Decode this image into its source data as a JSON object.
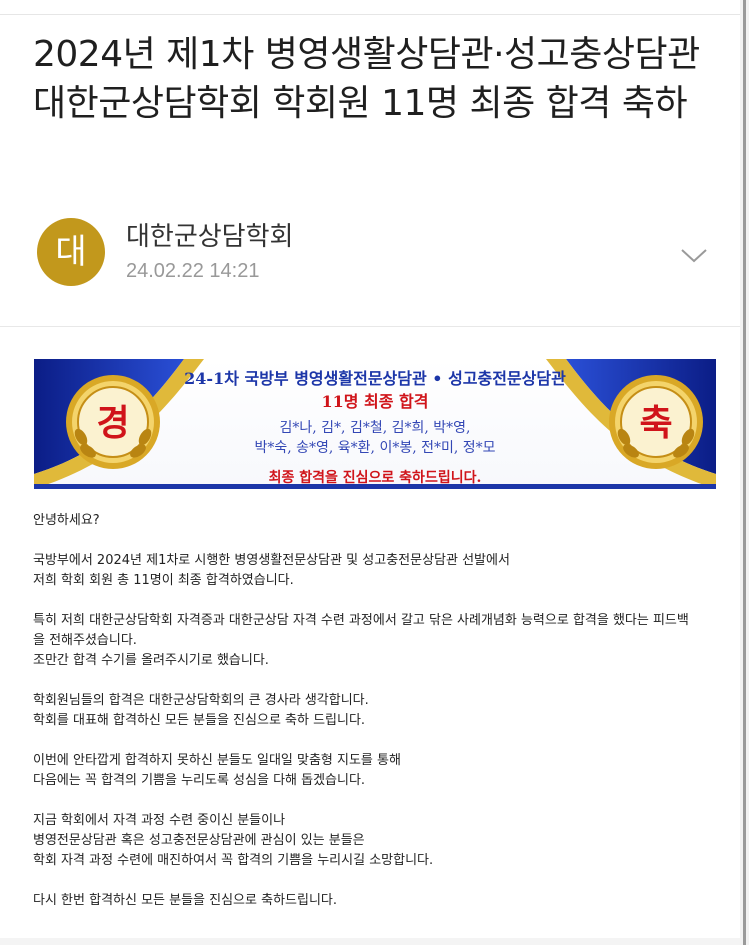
{
  "post": {
    "title": "2024년 제1차 병영생활상담관·성고충상담관 대한군상담학회 학회원 11명 최종 합격 축하",
    "avatar_char": "대",
    "author": "대한군상담학회",
    "date": "24.02.22 14:21"
  },
  "banner": {
    "line1": "24-1차 국방부 병영생활전문상담관 • 성고충전문상담관",
    "line2": "11명 최종 합격",
    "line3": "김*나, 김*, 김*철, 김*희, 박*영,",
    "line4": "박*숙, 송*영, 육*환, 이*봉, 전*미, 정*모",
    "line5": "최종 합격을 진심으로 축하드립니다.",
    "left_char": "경",
    "right_char": "축"
  },
  "body": {
    "p1": [
      "안녕하세요?"
    ],
    "p2": [
      "국방부에서 2024년 제1차로 시행한 병영생활전문상담관 및 성고충전문상담관 선발에서",
      "저희 학회 회원 총 11명이 최종 합격하였습니다."
    ],
    "p3": [
      "특히 저희 대한군상담학회 자격증과 대한군상담 자격 수련 과정에서 갈고 닦은 사례개념화 능력으로 합격을 했다는 피드백",
      "을 전해주셨습니다.",
      "조만간 합격 수기를 올려주시기로 했습니다."
    ],
    "p4": [
      "학회원님들의 합격은 대한군상담학회의 큰 경사라 생각합니다.",
      "학회를 대표해 합격하신 모든 분들을 진심으로 축하 드립니다."
    ],
    "p5": [
      "이번에 안타깝게 합격하지 못하신 분들도 일대일 맞춤형 지도를 통해",
      "다음에는 꼭 합격의 기쁨을 누리도록 성심을 다해 돕겠습니다."
    ],
    "p6": [
      "지금 학회에서 자격 과정 수련 중이신 분들이나",
      "병영전문상담관 혹은 성고충전문상담관에 관심이 있는 분들은",
      "학회 자격 과정 수련에 매진하여서 꼭 합격의 기쁨을 누리시길 소망합니다."
    ],
    "p7": [
      "다시 한번 합격하신 모든 분들을 진심으로 축하드립니다."
    ]
  },
  "colors": {
    "avatar": "#c2981c",
    "banner_blue": "#1c36a8",
    "banner_red": "#d0141a"
  },
  "icons": {
    "expand": "chevron-down-icon"
  }
}
